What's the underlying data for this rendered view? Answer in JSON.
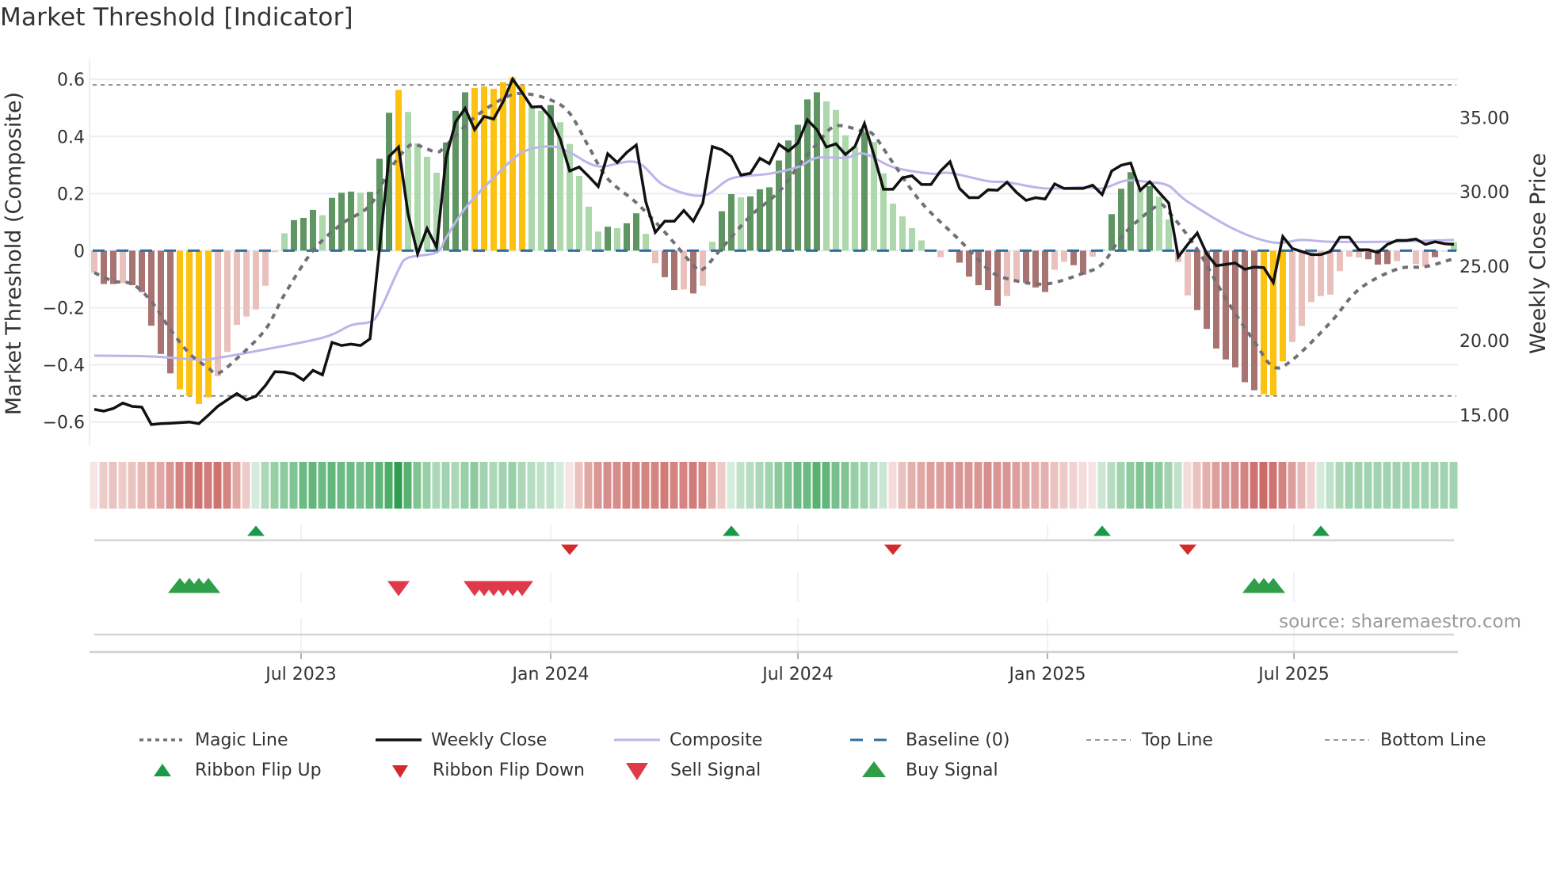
{
  "title": "Market Threshold [Indicator]",
  "source": "source: sharemaestro.com",
  "colors": {
    "bar_pos_dark": "#5f9563",
    "bar_pos_light": "#acd8ac",
    "bar_neg_dark": "#a87472",
    "bar_neg_light": "#eac0bd",
    "bar_extreme": "#fdc10f",
    "ribbon_green": "#2f9e4f",
    "ribbon_red": "#c2504c",
    "close": "#111111",
    "magic": "#707076",
    "composite": "#bdb4ea",
    "baseline": "#2f6f9f",
    "threshold": "#8a8a8a",
    "flip_up": "#1a9a48",
    "flip_down": "#d42a2a",
    "sell": "#e03a4a",
    "buy": "#2e9e48"
  },
  "chart_data": {
    "type": "bar+line",
    "title": "Market Threshold [Indicator]",
    "ylabel_left": "Market Threshold (Composite)",
    "ylabel_right": "Weekly Close Price",
    "ylim_left": [
      -0.665,
      0.67
    ],
    "ylim_right": [
      13.3,
      38.9
    ],
    "left_ticks": [
      {
        "v": 0.6,
        "label": "0.6"
      },
      {
        "v": 0.4,
        "label": "0.4"
      },
      {
        "v": 0.2,
        "label": "0.2"
      },
      {
        "v": 0,
        "label": "0"
      },
      {
        "v": -0.2,
        "label": "−0.2"
      },
      {
        "v": -0.4,
        "label": "−0.4"
      },
      {
        "v": -0.6,
        "label": "−0.6"
      }
    ],
    "right_ticks": [
      {
        "v": 35,
        "label": "35.00"
      },
      {
        "v": 30,
        "label": "30.00"
      },
      {
        "v": 25,
        "label": "25.00"
      },
      {
        "v": 20,
        "label": "20.00"
      },
      {
        "v": 15,
        "label": "15.00"
      }
    ],
    "x_ticks": [
      {
        "week": 22.75,
        "label": "Jul 2023"
      },
      {
        "week": 49,
        "label": "Jan 2024"
      },
      {
        "week": 75,
        "label": "Jul 2024"
      },
      {
        "week": 101.25,
        "label": "Jan 2025"
      },
      {
        "week": 127.17,
        "label": "Jul 2025"
      }
    ],
    "top_line": 0.581,
    "bottom_line": -0.509,
    "baseline": 0,
    "composite_bars": [
      -0.077,
      -0.117,
      -0.117,
      -0.114,
      -0.121,
      -0.145,
      -0.263,
      -0.362,
      -0.43,
      -0.486,
      -0.509,
      -0.537,
      -0.514,
      -0.44,
      -0.355,
      -0.26,
      -0.231,
      -0.206,
      -0.123,
      -0.005,
      0.061,
      0.107,
      0.115,
      0.143,
      0.124,
      0.185,
      0.203,
      0.207,
      0.203,
      0.206,
      0.322,
      0.483,
      0.563,
      0.486,
      0.376,
      0.329,
      0.273,
      0.379,
      0.49,
      0.555,
      0.57,
      0.575,
      0.567,
      0.59,
      0.607,
      0.58,
      0.507,
      0.49,
      0.51,
      0.45,
      0.374,
      0.262,
      0.154,
      0.067,
      0.084,
      0.079,
      0.096,
      0.131,
      0.059,
      -0.044,
      -0.093,
      -0.138,
      -0.136,
      -0.15,
      -0.123,
      0.031,
      0.138,
      0.198,
      0.187,
      0.19,
      0.215,
      0.222,
      0.316,
      0.386,
      0.441,
      0.53,
      0.555,
      0.523,
      0.493,
      0.404,
      0.364,
      0.414,
      0.381,
      0.271,
      0.165,
      0.12,
      0.079,
      0.036,
      0.0,
      -0.023,
      -0.002,
      -0.042,
      -0.091,
      -0.121,
      -0.138,
      -0.193,
      -0.159,
      -0.112,
      -0.112,
      -0.129,
      -0.145,
      -0.067,
      -0.039,
      -0.051,
      -0.084,
      -0.021,
      0.005,
      0.128,
      0.217,
      0.275,
      0.22,
      0.226,
      0.189,
      0.109,
      -0.04,
      -0.157,
      -0.208,
      -0.274,
      -0.343,
      -0.381,
      -0.409,
      -0.461,
      -0.489,
      -0.503,
      -0.507,
      -0.388,
      -0.32,
      -0.264,
      -0.18,
      -0.159,
      -0.154,
      -0.072,
      -0.021,
      -0.024,
      -0.03,
      -0.049,
      -0.047,
      -0.037,
      0.0,
      -0.047,
      -0.056,
      -0.023,
      0.0,
      0.03
    ],
    "bar_class": "LDDLDDDDDYYYYLLLLLLLLDDDLDDDLDDDYLLLLDDDYYYYYYLLDLLLLLDLDDLLDDLDLLDDLDDDDDDDDLLLLDLLLLLLLLLDDDDDLLDDDLLDDLLDDDLDLLLLDDDDDDDYYYLLLLLLLLDDDLLLLDLLD",
    "weekly_close": [
      15.39,
      15.27,
      15.45,
      15.81,
      15.59,
      15.54,
      14.37,
      14.43,
      14.46,
      14.5,
      14.54,
      14.43,
      15.0,
      15.6,
      16.03,
      16.45,
      16.03,
      16.27,
      16.99,
      17.92,
      17.89,
      17.76,
      17.35,
      18.01,
      17.71,
      19.89,
      19.68,
      19.77,
      19.68,
      20.13,
      26.23,
      32.38,
      33.01,
      28.53,
      25.84,
      27.54,
      26.29,
      32.29,
      34.71,
      35.61,
      34.18,
      35.07,
      34.89,
      36.06,
      37.58,
      36.68,
      35.7,
      35.73,
      34.98,
      33.55,
      31.4,
      31.67,
      31.04,
      30.36,
      32.56,
      31.97,
      32.65,
      33.15,
      29.34,
      27.28,
      28.03,
      28.03,
      28.75,
      28.03,
      29.25,
      33.05,
      32.83,
      32.38,
      31.13,
      31.25,
      32.26,
      31.9,
      33.19,
      32.74,
      33.28,
      34.84,
      34.18,
      33.01,
      33.23,
      32.51,
      33.05,
      34.59,
      32.47,
      30.18,
      30.18,
      30.95,
      31.08,
      30.5,
      30.5,
      31.4,
      32.03,
      30.23,
      29.61,
      29.61,
      30.14,
      30.11,
      30.65,
      29.96,
      29.43,
      29.61,
      29.52,
      30.54,
      30.23,
      30.23,
      30.23,
      30.45,
      29.82,
      31.4,
      31.79,
      31.94,
      30.11,
      30.68,
      29.96,
      29.25,
      25.63,
      26.47,
      27.24,
      25.84,
      25.04,
      25.13,
      25.22,
      24.8,
      24.95,
      24.91,
      23.91,
      27.0,
      26.2,
      25.99,
      25.79,
      25.79,
      25.99,
      26.95,
      26.95,
      26.11,
      26.11,
      25.93,
      26.47,
      26.74,
      26.74,
      26.83,
      26.47,
      26.65,
      26.52,
      26.47
    ],
    "composite_line": {
      "week": [
        1,
        7,
        12,
        14,
        18,
        25,
        28,
        30,
        31,
        33,
        34,
        37,
        38,
        40,
        43,
        46,
        49,
        51,
        54,
        58,
        61,
        65,
        68,
        72,
        75,
        77,
        80,
        82,
        85,
        89,
        91,
        95,
        97,
        101,
        105,
        107,
        109,
        110,
        112,
        114,
        116,
        121,
        125,
        128,
        131,
        137,
        144
      ],
      "price": [
        19.0,
        18.94,
        18.73,
        18.85,
        19.3,
        20.2,
        21.04,
        21.27,
        21.99,
        24.77,
        25.57,
        25.93,
        26.92,
        28.89,
        30.95,
        32.65,
        33.06,
        32.65,
        31.72,
        31.99,
        30.41,
        29.75,
        30.9,
        31.22,
        31.67,
        32.29,
        32.29,
        32.56,
        31.67,
        31.22,
        31.27,
        30.72,
        30.65,
        30.23,
        30.32,
        30.23,
        30.68,
        30.77,
        30.65,
        30.41,
        29.34,
        27.46,
        26.6,
        26.77,
        26.65,
        26.65,
        26.77
      ]
    },
    "magic_line": {
      "week": [
        1,
        3,
        5,
        7,
        9,
        11,
        13,
        14,
        16,
        19,
        21,
        24,
        27,
        30,
        32,
        34,
        35,
        37,
        38,
        41,
        44,
        46,
        49,
        51,
        53,
        55,
        58,
        61,
        64,
        65,
        67,
        70,
        73,
        75,
        77,
        79,
        82,
        83,
        85,
        88,
        92,
        95,
        97,
        101,
        105,
        107,
        109,
        111,
        113,
        114,
        117,
        120,
        123,
        125,
        127,
        131,
        134,
        138,
        141,
        144
      ],
      "value": [
        -0.077,
        -0.107,
        -0.117,
        -0.178,
        -0.276,
        -0.36,
        -0.411,
        -0.43,
        -0.378,
        -0.276,
        -0.154,
        0,
        0.093,
        0.159,
        0.28,
        0.364,
        0.369,
        0.346,
        0.369,
        0.467,
        0.533,
        0.551,
        0.528,
        0.481,
        0.364,
        0.252,
        0.168,
        0.065,
        -0.051,
        -0.065,
        0.009,
        0.121,
        0.206,
        0.294,
        0.374,
        0.437,
        0.416,
        0.404,
        0.308,
        0.168,
        0.037,
        -0.065,
        -0.098,
        -0.117,
        -0.079,
        -0.047,
        0.047,
        0.112,
        0.159,
        0.136,
        0.005,
        -0.168,
        -0.318,
        -0.407,
        -0.383,
        -0.252,
        -0.136,
        -0.065,
        -0.056,
        -0.028
      ]
    },
    "ribbon_strength": [
      -0.15,
      -0.3,
      -0.35,
      -0.3,
      -0.35,
      -0.4,
      -0.45,
      -0.5,
      -0.6,
      -0.7,
      -0.75,
      -0.8,
      -0.75,
      -0.8,
      -0.7,
      -0.5,
      -0.3,
      0.2,
      0.4,
      0.5,
      0.55,
      0.6,
      0.7,
      0.75,
      0.7,
      0.75,
      0.7,
      0.7,
      0.65,
      0.7,
      0.75,
      0.85,
      1.0,
      0.8,
      0.6,
      0.5,
      0.4,
      0.45,
      0.4,
      0.5,
      0.55,
      0.45,
      0.4,
      0.45,
      0.5,
      0.4,
      0.35,
      0.3,
      0.3,
      0.2,
      -0.15,
      -0.35,
      -0.5,
      -0.6,
      -0.65,
      -0.65,
      -0.7,
      -0.7,
      -0.7,
      -0.7,
      -0.75,
      -0.7,
      -0.7,
      -0.75,
      -0.7,
      -0.45,
      -0.3,
      0.2,
      0.3,
      0.35,
      0.4,
      0.45,
      0.55,
      0.6,
      0.7,
      0.7,
      0.8,
      0.75,
      0.65,
      0.6,
      0.5,
      0.45,
      0.35,
      0.25,
      -0.2,
      -0.35,
      -0.45,
      -0.5,
      -0.55,
      -0.55,
      -0.6,
      -0.6,
      -0.6,
      -0.6,
      -0.65,
      -0.6,
      -0.6,
      -0.55,
      -0.5,
      -0.45,
      -0.45,
      -0.35,
      -0.3,
      -0.25,
      -0.2,
      -0.15,
      0.25,
      0.35,
      0.45,
      0.55,
      0.6,
      0.6,
      0.55,
      0.45,
      0.3,
      -0.2,
      -0.35,
      -0.45,
      -0.55,
      -0.6,
      -0.65,
      -0.7,
      -0.8,
      -0.85,
      -0.8,
      -0.7,
      -0.55,
      -0.4,
      -0.25,
      0.2,
      0.3,
      0.4,
      0.45,
      0.45,
      0.45,
      0.45,
      0.45,
      0.45,
      0.45,
      0.45,
      0.45,
      0.45,
      0.45,
      0.45
    ],
    "ribbon_flip_up_weeks": [
      18,
      68,
      107,
      130
    ],
    "ribbon_flip_down_weeks": [
      51,
      85,
      116
    ],
    "buy_signal_weeks": [
      10,
      11,
      12,
      13,
      123,
      124,
      125
    ],
    "sell_signal_weeks": [
      33,
      41,
      42,
      43,
      44,
      45,
      46
    ]
  },
  "legend": [
    {
      "key": "magic",
      "label": "Magic Line"
    },
    {
      "key": "close",
      "label": "Weekly Close"
    },
    {
      "key": "composite",
      "label": "Composite"
    },
    {
      "key": "baseline",
      "label": "Baseline (0)"
    },
    {
      "key": "top",
      "label": "Top Line"
    },
    {
      "key": "bottom",
      "label": "Bottom Line"
    },
    {
      "key": "flip_up",
      "label": "Ribbon Flip Up"
    },
    {
      "key": "flip_down",
      "label": "Ribbon Flip Down"
    },
    {
      "key": "sell",
      "label": "Sell Signal"
    },
    {
      "key": "buy",
      "label": "Buy Signal"
    }
  ]
}
